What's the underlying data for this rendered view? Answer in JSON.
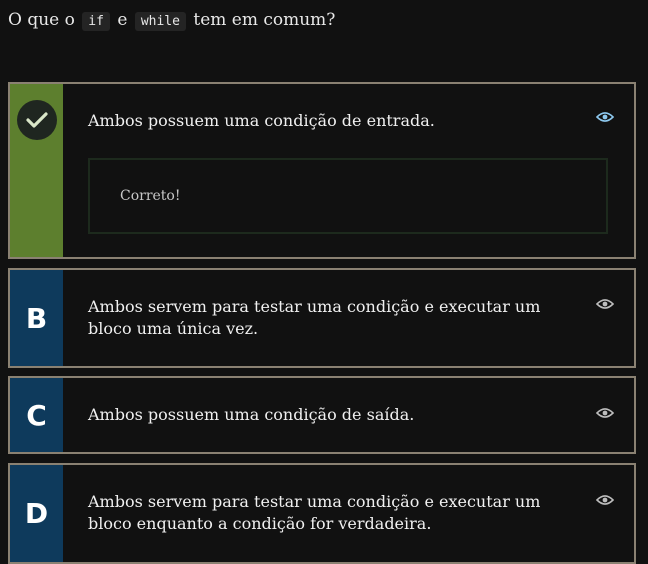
{
  "question": {
    "prefix": "O que o",
    "code1": "if",
    "middle": "e",
    "code2": "while",
    "suffix": "tem em comum?"
  },
  "options": [
    {
      "marker": "",
      "marker_icon": "checkmark-icon",
      "text": "Ambos possuem uma condição de entrada.",
      "status": "correct",
      "feedback": "Correto!"
    },
    {
      "marker": "B",
      "text": "Ambos servem para testar uma condição e executar um bloco uma única vez."
    },
    {
      "marker": "C",
      "text": "Ambos possuem uma condição de saída."
    },
    {
      "marker": "D",
      "text": "Ambos servem para testar uma condição e executar um bloco enquanto a condição for verdadeira."
    }
  ],
  "icons": {
    "show": "eye-icon"
  },
  "colors": {
    "correct_accent": "#5d7f2e",
    "option_accent": "#0e3a5c",
    "selected_eye": "#8ec9ef",
    "border": "#8a8172",
    "background": "#111111"
  }
}
